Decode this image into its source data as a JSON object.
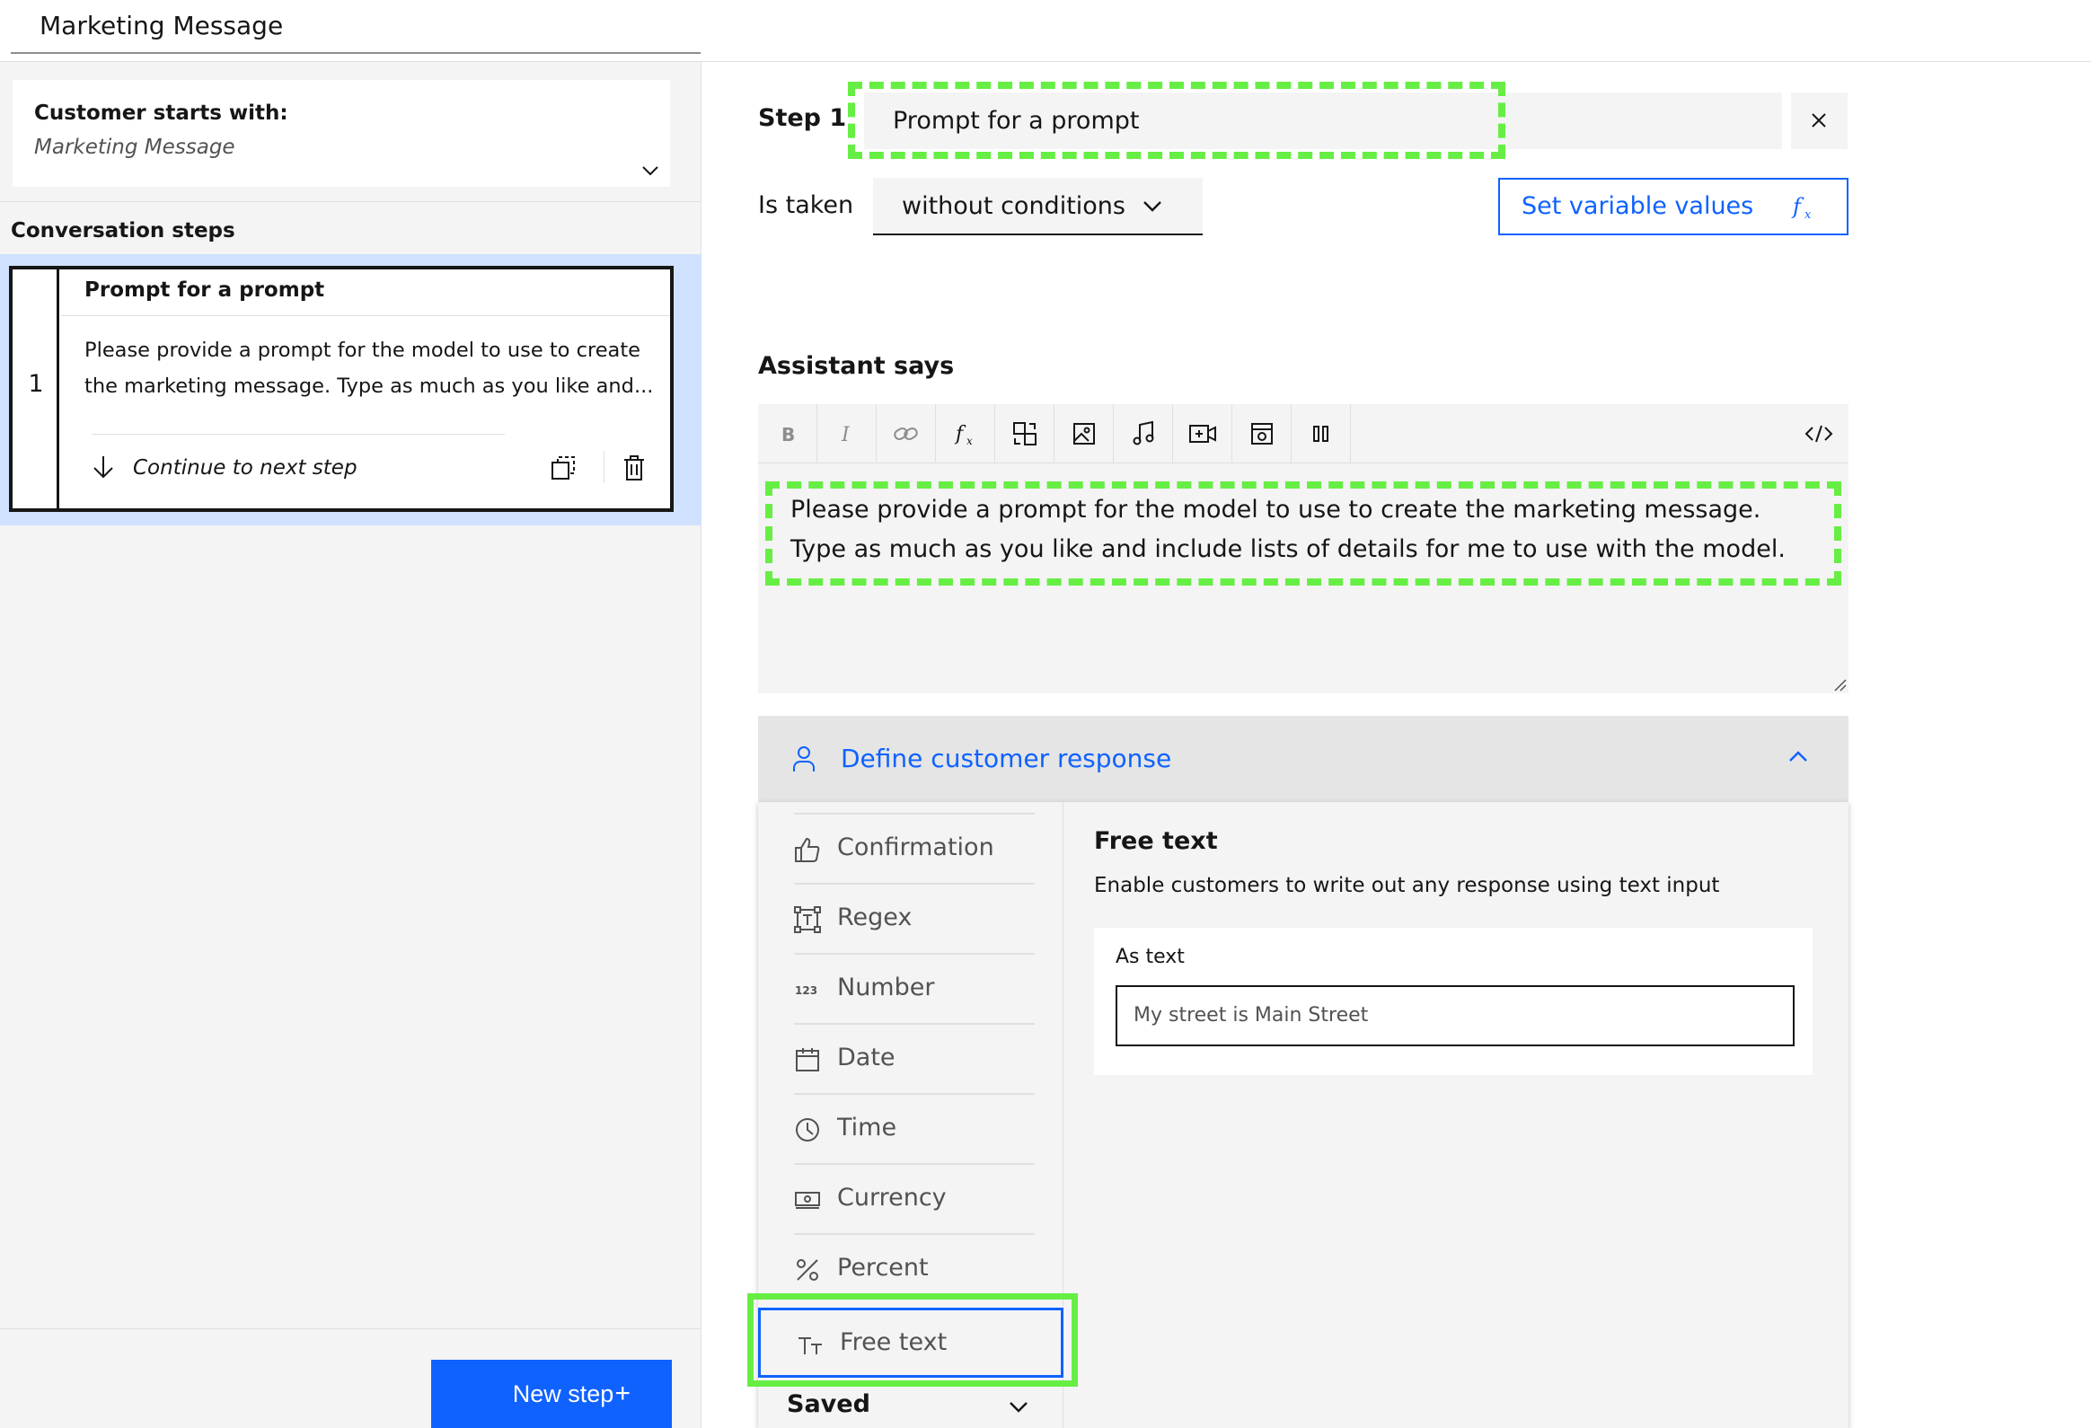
{
  "header": {
    "action_name": "Marketing Message"
  },
  "sidebar": {
    "starts_label": "Customer starts with:",
    "starts_value": "Marketing Message",
    "steps_heading": "Conversation steps",
    "steps": [
      {
        "number": "1",
        "title": "Prompt for a prompt",
        "body": "Please provide a prompt for the model to use to create the marketing message. Type as much as you like and...",
        "next": "Continue to next step"
      }
    ],
    "new_step_label": "New step",
    "new_step_icon": "+"
  },
  "step_editor": {
    "step_label": "Step 1",
    "step_name": "Prompt for a prompt",
    "is_taken_label": "Is taken",
    "condition": "without conditions",
    "set_variable_label": "Set variable values",
    "assistant_says_label": "Assistant says",
    "toolbar_icons": [
      "bold-icon",
      "italic-icon",
      "link-icon",
      "function-icon",
      "swap-icon",
      "image-icon",
      "music-icon",
      "video-icon",
      "iframe-icon",
      "pause-icon",
      "code-icon"
    ],
    "message_text": "Please provide a prompt for the model to use to create the marketing message. Type as much as you like and include lists of details for me to use with the model."
  },
  "customer_response": {
    "label": "Define customer response",
    "types": [
      {
        "label": "Confirmation",
        "icon": "thumbs-up-icon"
      },
      {
        "label": "Regex",
        "icon": "regex-icon"
      },
      {
        "label": "Number",
        "icon": "number-icon"
      },
      {
        "label": "Date",
        "icon": "calendar-icon"
      },
      {
        "label": "Time",
        "icon": "clock-icon"
      },
      {
        "label": "Currency",
        "icon": "currency-icon"
      },
      {
        "label": "Percent",
        "icon": "percent-icon"
      },
      {
        "label": "Free text",
        "icon": "text-icon",
        "selected": true
      }
    ],
    "saved_label": "Saved",
    "detail": {
      "heading": "Free text",
      "description": "Enable customers to write out any response using text input",
      "example_label": "As text",
      "example_value": "My street is Main Street"
    }
  },
  "colors": {
    "accent": "#0f62fe",
    "highlight": "#66ee44",
    "selected_bg": "#d0e2ff"
  }
}
